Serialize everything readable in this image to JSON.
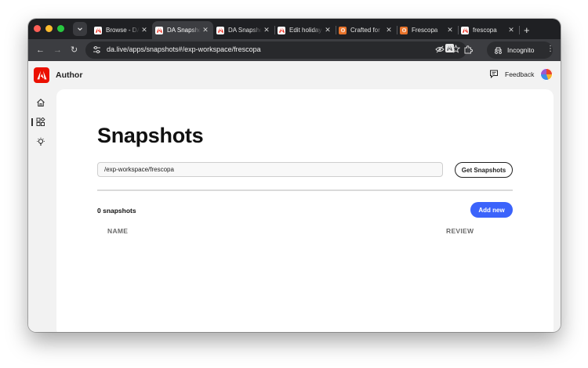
{
  "browser": {
    "tabs": [
      {
        "title": "Browse - DA",
        "favicon": "adobe-icon",
        "active": false
      },
      {
        "title": "DA Snapshots",
        "favicon": "adobe-icon",
        "active": true
      },
      {
        "title": "DA Snapshots",
        "favicon": "adobe-icon",
        "active": false
      },
      {
        "title": "Edit holiday",
        "favicon": "adobe-icon",
        "active": false
      },
      {
        "title": "Crafted for",
        "favicon": "frescopa-icon",
        "active": false
      },
      {
        "title": "Frescopa",
        "favicon": "frescopa-icon",
        "active": false
      },
      {
        "title": "frescopa",
        "favicon": "adobe-icon",
        "active": false
      }
    ],
    "new_tab": "+",
    "url": "da.live/apps/snapshots#/exp-workspace/frescopa",
    "incognito_label": "Incognito"
  },
  "app": {
    "brand": "Author",
    "feedback_label": "Feedback",
    "rail": [
      "home-icon",
      "apps-icon",
      "lightbulb-icon"
    ]
  },
  "page": {
    "title": "Snapshots",
    "path_value": "/exp-workspace/frescopa",
    "get_button": "Get Snapshots",
    "count_label": "0 snapshots",
    "add_button": "Add new",
    "columns": {
      "name": "NAME",
      "review": "REVIEW"
    }
  },
  "colors": {
    "adobe_red": "#eb1000",
    "primary_blue": "#3b63fb",
    "chrome_dark": "#1f2023",
    "chrome_toolbar": "#3c3d41"
  }
}
